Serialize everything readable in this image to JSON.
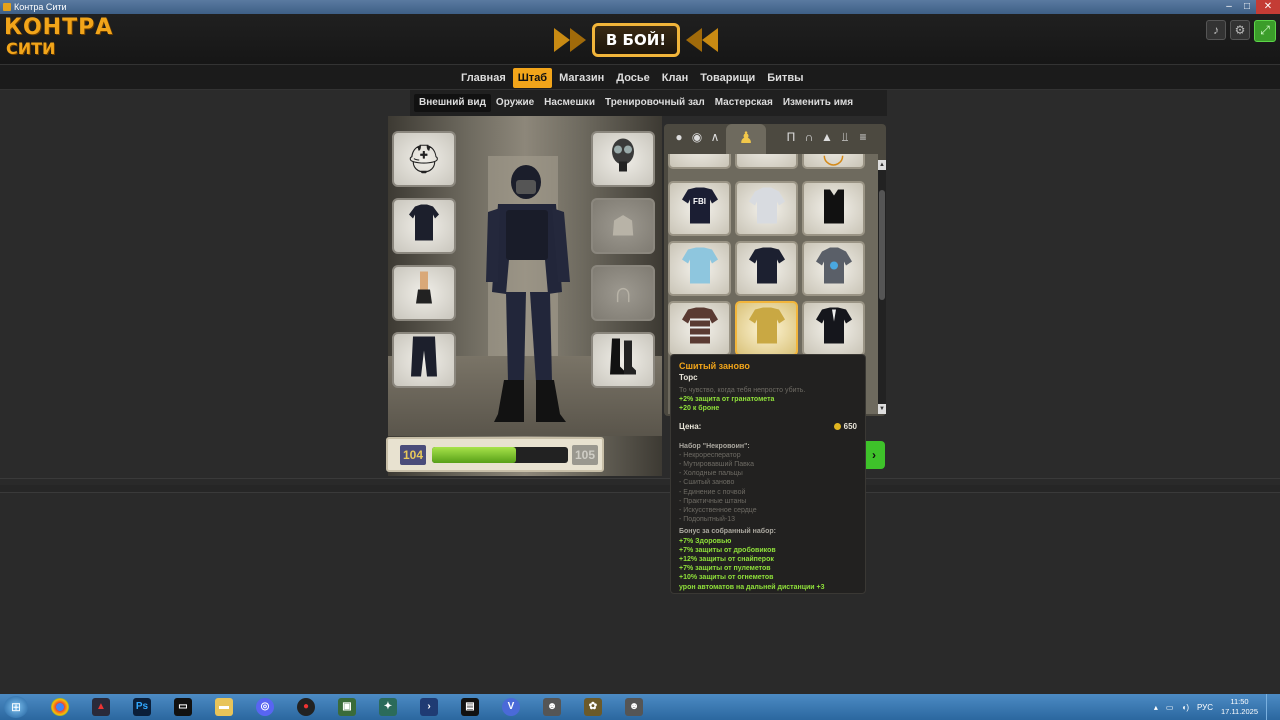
{
  "window": {
    "title": "Контра Сити",
    "controls": [
      "–",
      "□",
      "✕"
    ]
  },
  "header": {
    "logo_line1": "КОНТРА",
    "logo_line2": "СИТИ",
    "battle_label": "В БОЙ!",
    "icons": [
      "sound-icon",
      "settings-icon",
      "fullscreen-icon"
    ]
  },
  "main_nav": {
    "items": [
      {
        "label": "Главная"
      },
      {
        "label": "Штаб",
        "active": true
      },
      {
        "label": "Магазин"
      },
      {
        "label": "Досье"
      },
      {
        "label": "Клан"
      },
      {
        "label": "Товарищи"
      },
      {
        "label": "Битвы"
      }
    ]
  },
  "sub_nav": {
    "items": [
      {
        "label": "Внешний вид",
        "active": true
      },
      {
        "label": "Оружие"
      },
      {
        "label": "Насмешки"
      },
      {
        "label": "Тренировочный зал"
      },
      {
        "label": "Мастерская"
      },
      {
        "label": "Изменить имя"
      }
    ]
  },
  "equipment_slots": {
    "left": [
      "helmet-slot",
      "torso-slot",
      "gloves-slot",
      "pants-slot"
    ],
    "right": [
      "mask-slot",
      "empty-slot",
      "empty-slot",
      "boots-slot"
    ]
  },
  "level": {
    "current": "104",
    "next": "105",
    "progress": 0.62
  },
  "item_panel": {
    "selected_category": "torso",
    "item_labels": {
      "fbi": "FBI"
    },
    "scroll_up": "▲",
    "scroll_down": "▼"
  },
  "tooltip": {
    "name": "Сшитый заново",
    "type": "Торс",
    "description": "То чувство, когда тебя непросто убить.",
    "bonuses": [
      "+2% защита от гранатомета",
      "+20 к броне"
    ],
    "price_label": "Цена:",
    "price_value": "650",
    "set_title": "Набор \"Некровоин\":",
    "set_items": [
      "- Некроресператор",
      "- Мутировавший Павка",
      "- Холодные пальцы",
      "- Сшитый заново",
      "- Единение с почвой",
      "- Практичные штаны",
      "- Искусственное сердце",
      "- Подопытный-13"
    ],
    "set_bonus_title": "Бонус за собранный набор:",
    "set_bonuses": [
      "+7% Здоровью",
      "+7% защиты от дробовиков",
      "+12% защиты от снайперок",
      "+7% защиты от пулеметов",
      "+10% защиты от огнеметов",
      "урон автоматов на дальней дистанции +3"
    ]
  },
  "taskbar": {
    "apps": [
      "windows-start",
      "chrome",
      "launcher",
      "photoshop",
      "terminal",
      "file-explorer",
      "discord",
      "recorder",
      "game-app-1",
      "game-app-2",
      "powershell",
      "film-app",
      "vpn",
      "game-app-3",
      "game-app-4",
      "game-app-5"
    ],
    "language": "РУС",
    "time": "11:50",
    "date": "17.11.2025"
  }
}
